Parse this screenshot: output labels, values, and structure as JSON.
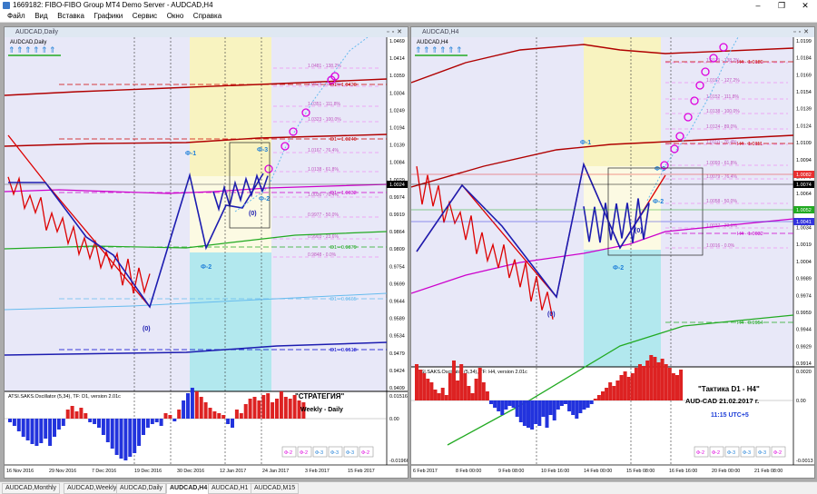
{
  "window": {
    "title": "1669182: FIBO-FIBO Group MT4 Demo Server - AUDCAD,H4"
  },
  "menu": [
    "Файл",
    "Вид",
    "Вставка",
    "Графики",
    "Сервис",
    "Окно",
    "Справка"
  ],
  "controls": {
    "minimize": "–",
    "maximize": "❐",
    "close": "✕"
  },
  "charts": [
    {
      "window_title": "AUDCAD,Daily",
      "symbol_label": "AUDCAD,Daily",
      "price_axis": [
        "1.0469",
        "1.0414",
        "1.0359",
        "1.0304",
        "1.0249",
        "1.0194",
        "1.0139",
        "1.0084",
        "1.0029",
        "0.9974",
        "0.9919",
        "0.9864",
        "0.9809",
        "0.9754",
        "0.9699",
        "0.9644",
        "0.9589",
        "0.9534",
        "0.9479",
        "0.9424",
        "0.9409"
      ],
      "current_price": "1.0024",
      "h_levels": [
        {
          "text": "D1 - 1.0420",
          "color": "#cc0000"
        },
        {
          "text": "D1 - 1.0240",
          "color": "#cc0000"
        },
        {
          "text": "D1 - 1.0032",
          "color": "#cc00cc"
        },
        {
          "text": "D1 - 0.9879",
          "color": "#22aa22"
        },
        {
          "text": "D1 - 0.9665",
          "color": "#66bbee"
        },
        {
          "text": "D1 - 0.9518",
          "color": "#0000cc"
        }
      ],
      "fib_labels": [
        "1.0481 - 138.2%",
        "1.0414 - 127.2%",
        "1.0351 - 111.8%",
        "1.0323 - 100.0%",
        "1.0167 - 76.4%",
        "1.0138 - 61.8%",
        "1.0036 - 76.4%",
        "0.9977 - 50.0%",
        "0.9903 - 23.6%",
        "0.9848 - 0.0%"
      ],
      "phi_labels": [
        "Ф-1",
        "Ф-2",
        "Ф-3",
        "Ф-2",
        "(0)",
        "(0)"
      ],
      "oscillator_label": "ATSI.SAKS.Oscillator (5,34), TF: D1,  version 2.01c",
      "osc_axis": [
        "0.01516",
        "0.00",
        "-0.01966"
      ],
      "time_axis": [
        "16 Nov 2016",
        "29 Nov 2016",
        "7 Dec 2016",
        "19 Dec 2016",
        "30 Dec 2016",
        "12 Jan 2017",
        "24 Jan 2017",
        "3 Feb 2017",
        "15 Feb 2017"
      ],
      "annotation": [
        "\"СТРАТЕГИЯ\"",
        "Weekly - Daily"
      ],
      "phi_buttons": [
        "Ф-2",
        "Ф-2",
        "Ф-3",
        "Ф-3",
        "Ф-3",
        "Ф-2"
      ]
    },
    {
      "window_title": "AUDCAD,H4",
      "symbol_label": "AUDCAD,H4",
      "price_axis": [
        "1.0199",
        "1.0184",
        "1.0169",
        "1.0154",
        "1.0139",
        "1.0124",
        "1.0109",
        "1.0094",
        "1.0079",
        "1.0064",
        "1.0049",
        "1.0034",
        "1.0019",
        "1.0004",
        "0.9989",
        "0.9974",
        "0.9959",
        "0.9944",
        "0.9929",
        "0.9914"
      ],
      "price_tags": [
        {
          "text": "1.0082",
          "bg": "#e83030"
        },
        {
          "text": "1.0074",
          "bg": "#000000"
        },
        {
          "text": "1.0052",
          "bg": "#22aa22"
        },
        {
          "text": "1.0041",
          "bg": "#3333dd"
        }
      ],
      "h_levels": [
        {
          "text": "H4 - 1.0189",
          "color": "#cc0000"
        },
        {
          "text": "H4 - 1.0111",
          "color": "#cc0000"
        },
        {
          "text": "H4 - 1.0032",
          "color": "#cc00cc"
        },
        {
          "text": "H4 - 0.9954",
          "color": "#22aa22"
        }
      ],
      "fib_labels": [
        "1.0179 - 138.2%",
        "1.0167 - 127.2%",
        "1.0152 - 111.8%",
        "1.0138 - 100.0%",
        "1.0124 - 89.0%",
        "1.0110 - 76.4%",
        "1.0093 - 61.8%",
        "1.0079 - 76.4%",
        "1.0058 - 50.0%",
        "1.0037 - 23.6%",
        "1.0016 - 0.0%"
      ],
      "phi_labels": [
        "Ф-1",
        "Ф-2",
        "Ф-3",
        "Ф-2",
        "(0)",
        "(0)"
      ],
      "oscillator_label": "ATSI.SAKS.Oscillator (5,34), TF: H4,  version 2.01c",
      "osc_axis": [
        "0.0020",
        "0.00",
        "-0.0013"
      ],
      "time_axis": [
        "6 Feb 2017",
        "8 Feb 00:00",
        "9 Feb 08:00",
        "10 Feb 16:00",
        "14 Feb 00:00",
        "15 Feb 08:00",
        "16 Feb 16:00",
        "20 Feb 00:00",
        "21 Feb 08:00"
      ],
      "annotation": [
        "\"Тактика D1 - H4\"",
        "AUD-CAD    21.02.2017 г.",
        "11:15     UTC+5"
      ],
      "phi_buttons": [
        "Ф-2",
        "Ф-2",
        "Ф-3",
        "Ф-3",
        "Ф-3",
        "Ф-2"
      ]
    }
  ],
  "tabs": [
    {
      "label": "AUDCAD,Monthly",
      "active": false
    },
    {
      "label": "AUDCAD,Weekly",
      "active": false
    },
    {
      "label": "AUDCAD,Daily",
      "active": false
    },
    {
      "label": "AUDCAD,H4",
      "active": true
    },
    {
      "label": "AUDCAD,H1",
      "active": false
    },
    {
      "label": "AUDCAD,M15",
      "active": false
    }
  ],
  "colors": {
    "bg_plot": "#e8e8f8",
    "yellow_zone": "#f8f3c0",
    "cyan_zone": "#a8e8ec",
    "red": "#dd0000",
    "blue": "#1c1cb0",
    "magenta": "#cc00cc",
    "green": "#22aa22",
    "dark_red": "#b00000",
    "light_blue": "#66bbee",
    "pink": "#ee66ee"
  }
}
